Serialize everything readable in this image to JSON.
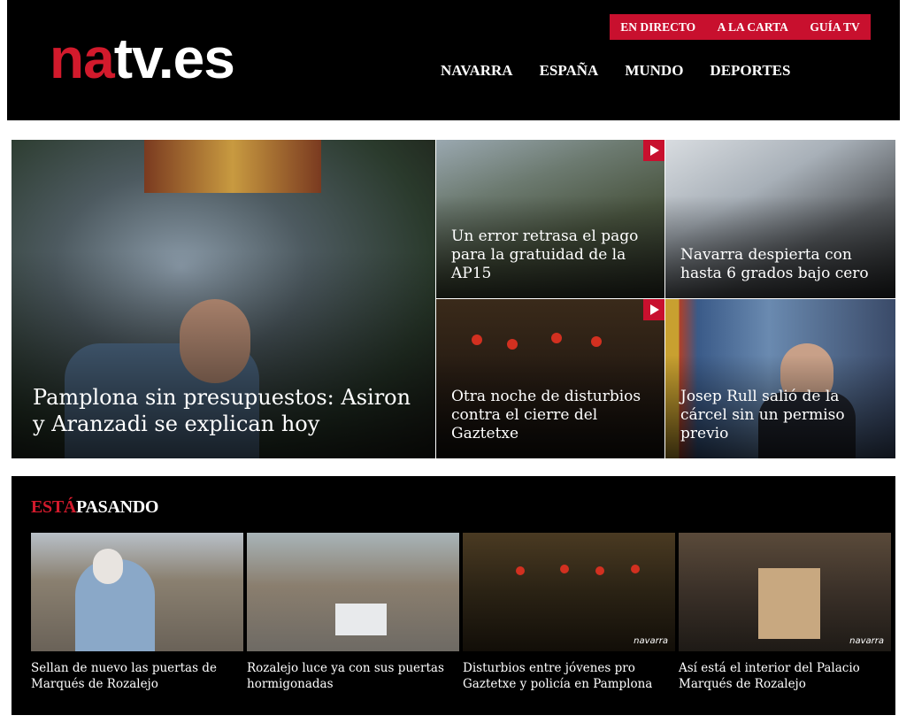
{
  "header": {
    "logo_na": "na",
    "logo_tv": "tv.es",
    "top_links": [
      "EN DIRECTO",
      "A LA CARTA",
      "GUÍA TV"
    ],
    "nav": [
      "NAVARRA",
      "ESPAÑA",
      "MUNDO",
      "DEPORTES"
    ]
  },
  "featured": {
    "main_title": "Pamplona sin presupuestos: Asiron y Aranzadi se explican hoy",
    "tiles": [
      "Un error retrasa el pago para la gratuidad de la AP15",
      "Navarra despierta con hasta 6 grados bajo cero",
      "Otra noche de disturbios contra el cierre del Gaztetxe",
      "Josep Rull salió de la cárcel sin un permiso previo"
    ]
  },
  "esta_pasando": {
    "title_red": "ESTÁ",
    "title_white": "PASANDO",
    "cards": [
      "Sellan de nuevo las puertas de Marqués de Rozalejo",
      "Rozalejo luce ya con sus puertas hormigonadas",
      "Disturbios entre jóvenes pro Gaztetxe y policía en Pamplona",
      "Así está el interior del Palacio Marqués de Rozalejo"
    ],
    "watermark": "navarra"
  },
  "colors": {
    "brand_red": "#c8102e",
    "logo_red": "#d21a2c",
    "background": "#000000"
  }
}
